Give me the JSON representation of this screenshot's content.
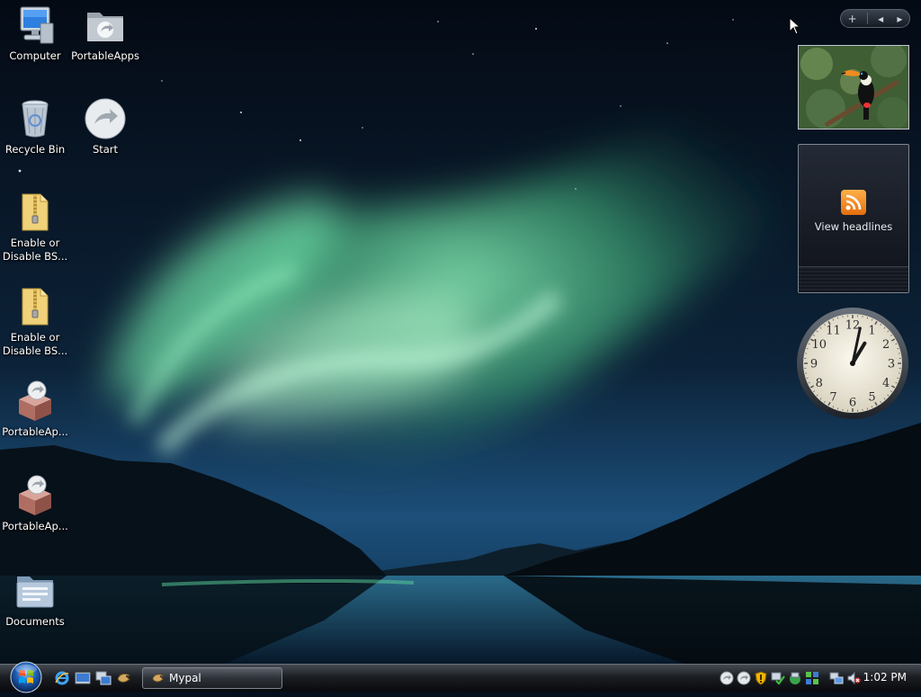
{
  "desktop": {
    "icons": [
      {
        "label": "Computer",
        "icon": "computer-icon"
      },
      {
        "label": "PortableApps",
        "icon": "portableapps-folder-icon"
      },
      {
        "label": "Recycle Bin",
        "icon": "recycle-bin-icon"
      },
      {
        "label": "Start",
        "icon": "portableapps-start-icon"
      },
      {
        "label": "Enable or\nDisable BS...",
        "icon": "zip-folder-icon"
      },
      {
        "label": "Enable or\nDisable BS...",
        "icon": "zip-folder-icon"
      },
      {
        "label": "PortableAp...",
        "icon": "portableapps-package-icon"
      },
      {
        "label": "PortableAp...",
        "icon": "portableapps-package-icon"
      },
      {
        "label": "Documents",
        "icon": "documents-folder-icon"
      }
    ]
  },
  "sidebar": {
    "toolbar": {
      "add": "+",
      "prev": "◂",
      "next": "▸"
    },
    "feed_gadget": {
      "label": "View headlines"
    },
    "clock_gadget": {
      "numbers": [
        "12",
        "1",
        "2",
        "3",
        "4",
        "5",
        "6",
        "7",
        "8",
        "9",
        "10",
        "11"
      ],
      "time_hour": 1,
      "time_minute": 2
    }
  },
  "taskbar": {
    "start_icon": "windows-orb-icon",
    "quick_launch": [
      "show-desktop-icon",
      "internet-explorer-icon",
      "switch-windows-icon",
      "network-icon",
      "mypal-icon"
    ],
    "task_button": {
      "label": "Mypal",
      "icon": "mypal-icon"
    },
    "tray_icons": [
      "portableapps-tray-icon",
      "portableapps-tray-icon",
      "security-shield-icon",
      "network-check-icon",
      "network-connections-icon",
      "network-status-icon",
      "network-computers-icon",
      "volume-muted-icon"
    ],
    "clock": "1:02 PM"
  },
  "colors": {
    "aurora": "#5ee0a0",
    "sky_top": "#050d1a",
    "taskbar": "#1b1e23"
  }
}
